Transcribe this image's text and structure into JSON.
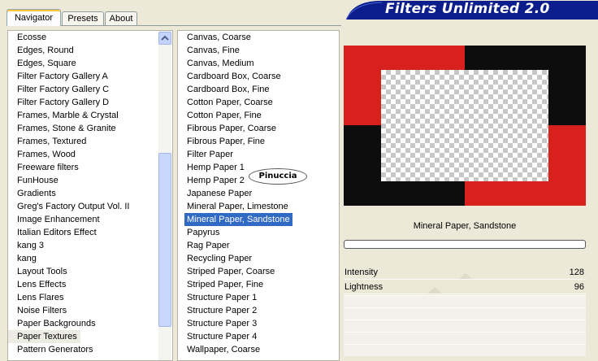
{
  "tabs": [
    "Navigator",
    "Presets",
    "About"
  ],
  "banner": {
    "title": "Filters Unlimited 2.0"
  },
  "categories": {
    "items": [
      "Ecosse",
      "Edges, Round",
      "Edges, Square",
      "Filter Factory Gallery A",
      "Filter Factory Gallery C",
      "Filter Factory Gallery D",
      "Frames, Marble & Crystal",
      "Frames, Stone & Granite",
      "Frames, Textured",
      "Frames, Wood",
      "Freeware filters",
      "FunHouse",
      "Gradients",
      "Greg's Factory Output Vol. II",
      "Image Enhancement",
      "Italian Editors Effect",
      "kang 3",
      "kang",
      "Layout Tools",
      "Lens Effects",
      "Lens Flares",
      "Noise Filters",
      "Paper Backgrounds",
      "Paper Textures",
      "Pattern Generators"
    ],
    "highlighted_index": 23
  },
  "filters": {
    "items": [
      "Canvas, Coarse",
      "Canvas, Fine",
      "Canvas, Medium",
      "Cardboard Box, Coarse",
      "Cardboard Box, Fine",
      "Cotton Paper, Coarse",
      "Cotton Paper, Fine",
      "Fibrous Paper, Coarse",
      "Fibrous Paper, Fine",
      "Filter Paper",
      "Hemp Paper 1",
      "Hemp Paper 2",
      "Japanese Paper",
      "Mineral Paper, Limestone",
      "Mineral Paper, Sandstone",
      "Papyrus",
      "Rag Paper",
      "Recycling Paper",
      "Striped Paper, Coarse",
      "Striped Paper, Fine",
      "Structure Paper 1",
      "Structure Paper 2",
      "Structure Paper 3",
      "Structure Paper 4",
      "Wallpaper, Coarse"
    ],
    "selected_index": 14
  },
  "watermark": "Pinuccia",
  "selected_filter_name": "Mineral Paper, Sandstone",
  "sliders": [
    {
      "label": "Intensity",
      "value": "128",
      "level": 128
    },
    {
      "label": "Lightness",
      "value": "96",
      "level": 96
    }
  ],
  "colors": {
    "accent": "#316ac5",
    "red": "#d8201c",
    "black": "#0d0d0d",
    "banner": "#0b1e8c"
  }
}
